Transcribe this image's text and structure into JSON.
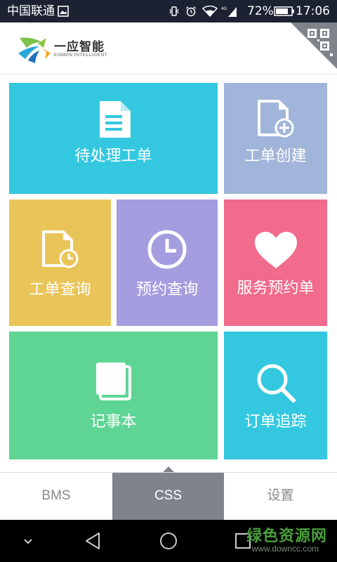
{
  "status_bar": {
    "carrier": "中国联通",
    "battery_percent": "72%",
    "time": "17:06",
    "icons": [
      "image-icon",
      "vibrate-icon",
      "alarm-icon",
      "wifi-icon",
      "signal-4g-icon",
      "battery-icon"
    ]
  },
  "header": {
    "brand_name": "一应智能",
    "brand_subtitle": "EINWIN INTELLIGENT",
    "corner_icon": "qr-code-icon"
  },
  "tiles": [
    {
      "label": "待处理工单",
      "color": "#33c8e0",
      "icon": "document-icon"
    },
    {
      "label": "工单创建",
      "color": "#a0b5d9",
      "icon": "document-add-icon"
    },
    {
      "label": "工单查询",
      "color": "#e9c559",
      "icon": "document-clock-icon"
    },
    {
      "label": "预约查询",
      "color": "#a49ddf",
      "icon": "clock-icon"
    },
    {
      "label": "服务预约单",
      "color": "#f06b8c",
      "icon": "heart-icon"
    },
    {
      "label": "记事本",
      "color": "#5fd595",
      "icon": "notebook-icon"
    },
    {
      "label": "订单追踪",
      "color": "#33c8e0",
      "icon": "search-icon"
    }
  ],
  "tabs": [
    {
      "label": "BMS",
      "active": false
    },
    {
      "label": "CSS",
      "active": true
    },
    {
      "label": "设置",
      "active": false
    }
  ],
  "nav": [
    "chevron-down-icon",
    "back-icon",
    "home-icon",
    "recents-icon"
  ],
  "watermark": {
    "main": "绿色资源网",
    "sub": "www.downcc.com"
  }
}
